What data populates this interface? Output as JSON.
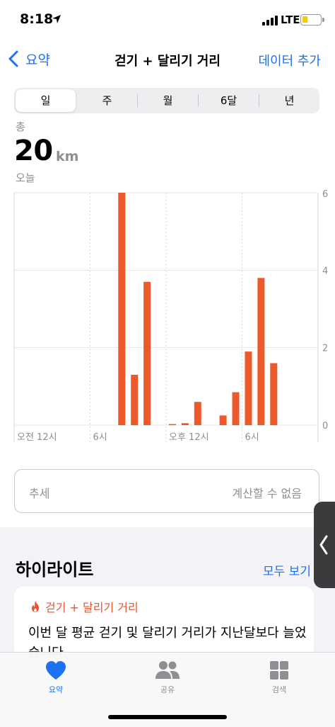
{
  "status_bar": {
    "time": "8:18",
    "network": "LTE"
  },
  "nav": {
    "back_label": "요약",
    "title": "걷기 + 달리기 거리",
    "add_data": "데이터 추가"
  },
  "segments": [
    "일",
    "주",
    "월",
    "6달",
    "년"
  ],
  "summary": {
    "total_label": "총",
    "value": "20",
    "unit": "km",
    "date_label": "오늘"
  },
  "chart_data": {
    "type": "bar",
    "x_tick_labels": [
      "오전 12시",
      "6시",
      "오후 12시",
      "6시"
    ],
    "y_tick_labels": [
      "6",
      "4",
      "2",
      "0"
    ],
    "ylim": [
      0,
      6
    ],
    "grid": true,
    "bars": [
      {
        "hour": 8,
        "value": 6.0
      },
      {
        "hour": 9,
        "value": 1.3
      },
      {
        "hour": 10,
        "value": 3.7
      },
      {
        "hour": 12,
        "value": 0.02
      },
      {
        "hour": 13,
        "value": 0.05
      },
      {
        "hour": 14,
        "value": 0.6
      },
      {
        "hour": 16,
        "value": 0.25
      },
      {
        "hour": 17,
        "value": 0.85
      },
      {
        "hour": 18,
        "value": 1.9
      },
      {
        "hour": 19,
        "value": 3.8
      },
      {
        "hour": 20,
        "value": 1.6
      }
    ],
    "bar_color": "#ec5a2b"
  },
  "trend": {
    "label": "추세",
    "value": "계산할 수 없음"
  },
  "highlights": {
    "title": "하이라이트",
    "show_all": "모두 보기",
    "card": {
      "category": "걷기 + 달리기 거리",
      "text": "이번 달 평균 걷기 및 달리기 거리가 지난달보다 늘었습니다."
    }
  },
  "tabs": [
    {
      "label": "요약",
      "icon": "heart-icon",
      "color": "#1d72f3"
    },
    {
      "label": "공유",
      "icon": "people-icon",
      "color": "#8e8e93"
    },
    {
      "label": "검색",
      "icon": "grid-icon",
      "color": "#8e8e93"
    }
  ]
}
